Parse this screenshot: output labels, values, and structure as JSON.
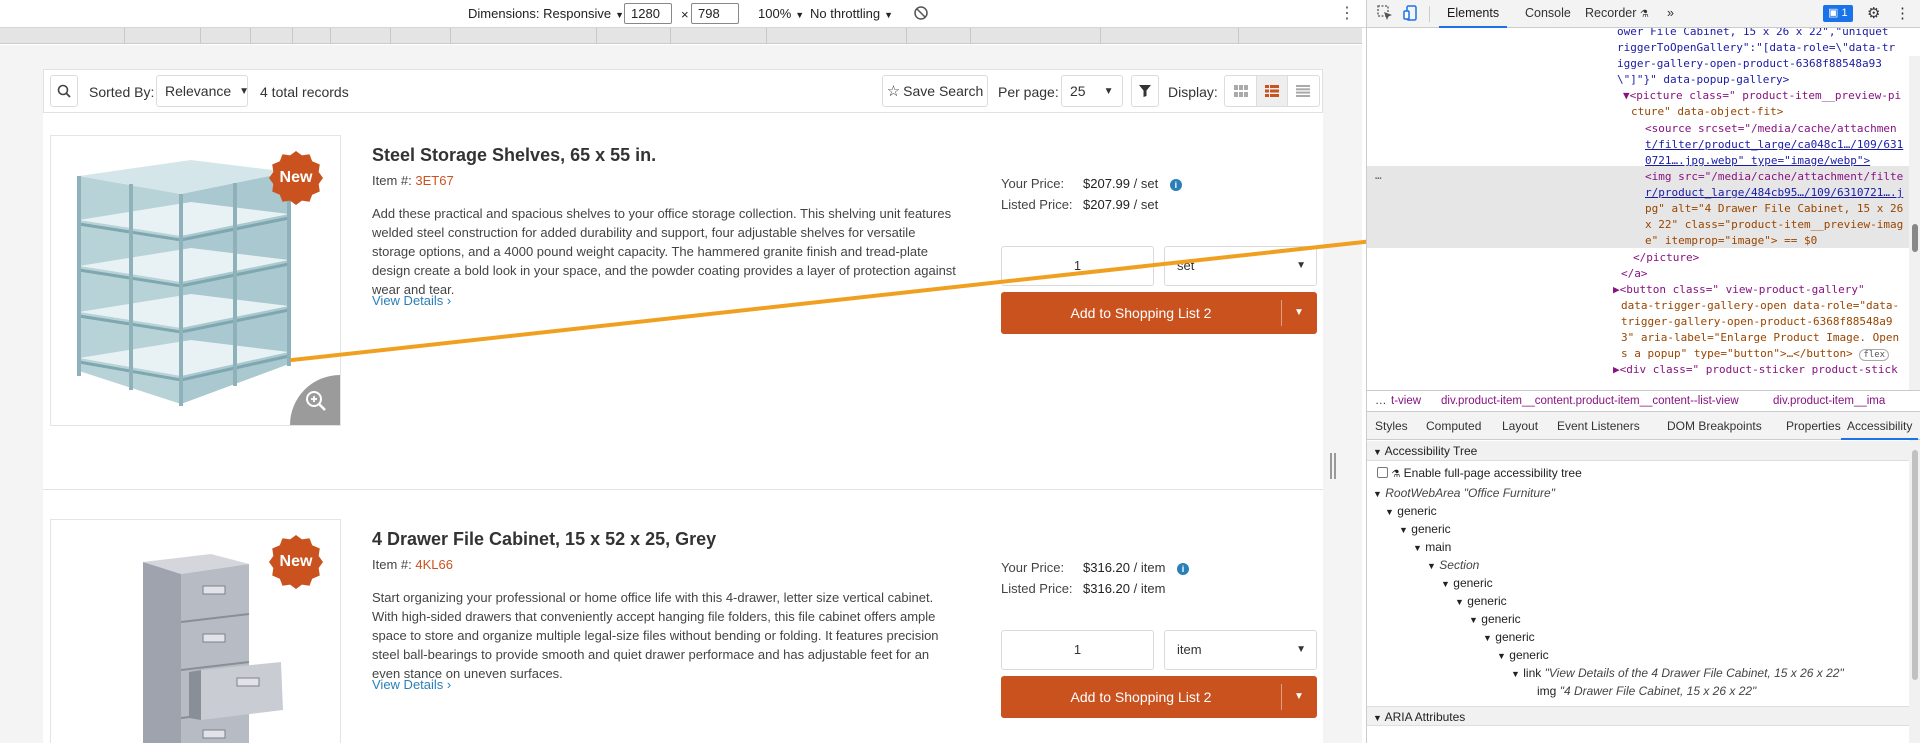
{
  "devbar": {
    "dimensions_label": "Dimensions: Responsive",
    "width": "1280",
    "times": "×",
    "height": "798",
    "zoom": "100%",
    "throttling": "No throttling"
  },
  "toolbar": {
    "sorted_by_label": "Sorted By:",
    "sort_value": "Relevance",
    "total_records": "4 total records",
    "save_search": "Save Search",
    "per_page_label": "Per page:",
    "per_page_value": "25",
    "display_label": "Display:"
  },
  "products": [
    {
      "badge": "New",
      "title": "Steel Storage Shelves, 65 x 55 in.",
      "item_label": "Item #:",
      "sku": "3ET67",
      "description": "Add these practical and spacious shelves to your office storage collection. This shelving unit features welded steel construction for added durability and support, four adjustable shelves for versatile storage options, and a 4000 pound weight capacity. The hammered granite finish and tread-plate design create a bold look in your space, and the powder coating provides a layer of protection against wear and tear.",
      "view_details": "View Details",
      "your_price_label": "Your Price:",
      "your_price": "$207.99",
      "your_price_unit": "/ set",
      "listed_price_label": "Listed Price:",
      "listed_price": "$207.99",
      "listed_price_unit": "/ set",
      "qty": "1",
      "unit": "set",
      "add_button": "Add to Shopping List 2"
    },
    {
      "badge": "New",
      "title": "4 Drawer File Cabinet, 15 x 52 x 25, Grey",
      "item_label": "Item #:",
      "sku": "4KL66",
      "description": "Start organizing your professional or home office life with this 4-drawer, letter size vertical cabinet. With high-sided drawers that conveniently accept hanging file folders, this file cabinet offers ample space to store and organize multiple legal-size files without bending or folding. It features precision steel ball-bearings to provide smooth and quiet drawer performace and has adjustable feet for an even stance on uneven surfaces.",
      "view_details": "View Details",
      "your_price_label": "Your Price:",
      "your_price": "$316.20",
      "your_price_unit": "/ item",
      "listed_price_label": "Listed Price:",
      "listed_price": "$316.20",
      "listed_price_unit": "/ item",
      "qty": "1",
      "unit": "item",
      "add_button": "Add to Shopping List 2"
    }
  ],
  "devtools": {
    "tabs": [
      "Elements",
      "Console",
      "Recorder",
      "»"
    ],
    "active_tab": "Elements",
    "message_count": "1",
    "code_lines": [
      "ower File Cabinet, 15 x 26 x 22\",\"uniquet",
      "riggerToOpenGallery\":\"[data-role=\\\"data-tr",
      "igger-gallery-open-product-6368f88548a93",
      "\\\"]\"}\" data-popup-gallery>",
      "▼<picture class=\" product-item__preview-pi",
      "cture\" data-object-fit>",
      "<source srcset=\"/media/cache/attachmen",
      "t/filter/product_large/ca048c1…/109/631",
      "0721….jpg.webp\" type=\"image/webp\">",
      "<img src=\"/media/cache/attachment/filte",
      "r/product_large/484cb95…/109/6310721….j",
      "pg\" alt=\"4 Drawer File Cabinet, 15 x 26",
      "x 22\" class=\"product-item__preview-imag",
      "e\" itemprop=\"image\"> == $0",
      "</picture>",
      "</a>",
      "▶<button class=\" view-product-gallery\"",
      "data-trigger-gallery-open data-role=\"data-",
      "trigger-gallery-open-product-6368f88548a9",
      "3\" aria-label=\"Enlarge Product Image. Open",
      "s a popup\" type=\"button\">…</button>",
      "▶<div class=\" product-sticker product-stick"
    ],
    "flex_badge": "flex",
    "crumbs": [
      "…",
      "t-view",
      "div.product-item__content.product-item__content--list-view",
      "div.product-item__ima"
    ],
    "subtabs": [
      "Styles",
      "Computed",
      "Layout",
      "Event Listeners",
      "DOM Breakpoints",
      "Properties",
      "Accessibility"
    ],
    "active_subtab": "Accessibility",
    "a11y_tree_heading": "Accessibility Tree",
    "enable_full_page": "Enable full-page accessibility tree",
    "root_label": "RootWebArea",
    "root_name": "\"Office Furniture\"",
    "tree_nodes": [
      "generic",
      "generic",
      "main",
      "Section",
      "generic",
      "generic",
      "generic",
      "generic",
      "generic"
    ],
    "link_label": "link",
    "link_name": "\"View Details of the 4 Drawer File Cabinet, 15 x 26 x 22\"",
    "img_label": "img",
    "img_name": "\"4 Drawer File Cabinet, 15 x 26 x 22\"",
    "aria_heading": "ARIA Attributes"
  }
}
